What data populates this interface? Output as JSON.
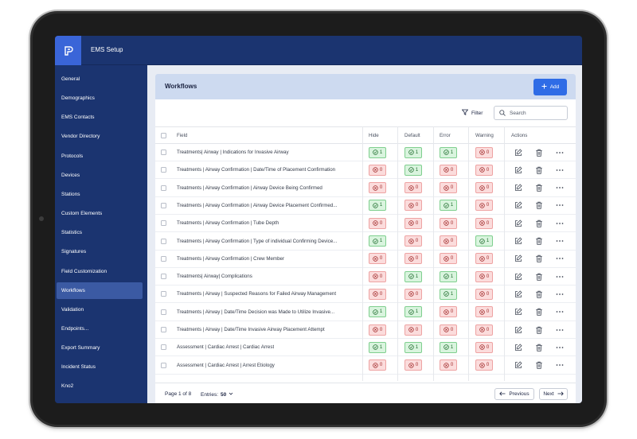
{
  "app": {
    "title": "EMS Setup"
  },
  "sidebar": {
    "items": [
      {
        "label": "General"
      },
      {
        "label": "Demographics"
      },
      {
        "label": "EMS Contacts"
      },
      {
        "label": "Vendor Directory"
      },
      {
        "label": "Protocols"
      },
      {
        "label": "Devices"
      },
      {
        "label": "Stations"
      },
      {
        "label": "Custom Elements"
      },
      {
        "label": "Statistics"
      },
      {
        "label": "Signatures"
      },
      {
        "label": "Field Customization"
      },
      {
        "label": "Workflows",
        "active": true
      },
      {
        "label": "Validation"
      },
      {
        "label": "Endpoints..."
      },
      {
        "label": "Export Summary"
      },
      {
        "label": "Incident Status"
      },
      {
        "label": "Kno2"
      }
    ]
  },
  "card": {
    "title": "Workflows",
    "add_label": "Add",
    "filter_label": "Filter",
    "search_placeholder": "Search"
  },
  "table": {
    "columns": {
      "field": "Field",
      "hide": "Hide",
      "default": "Default",
      "error": "Error",
      "warning": "Warning",
      "actions": "Actions"
    },
    "rows": [
      {
        "field": "Treatments| Airway | Indications for Invasive Airway",
        "hide": "1",
        "default": "1",
        "error": "1",
        "warning": "0"
      },
      {
        "field": "Treatments | Airway Confirmation | Date/Time of Placement Confirmation",
        "hide": "0",
        "default": "1",
        "error": "0",
        "warning": "0"
      },
      {
        "field": "Treatments | Airway Confirmation | Airway Device Being Confirmed",
        "hide": "0",
        "default": "0",
        "error": "0",
        "warning": "0"
      },
      {
        "field": "Treatments | Airway Confirmation | Airway Device Placement Confirmed...",
        "hide": "1",
        "default": "0",
        "error": "1",
        "warning": "0"
      },
      {
        "field": "Treatments | Airway Confirmation | Tube Depth",
        "hide": "0",
        "default": "0",
        "error": "0",
        "warning": "0"
      },
      {
        "field": "Treatments | Airway Confirmation | Type of individual Confirming Device...",
        "hide": "1",
        "default": "0",
        "error": "0",
        "warning": "1"
      },
      {
        "field": "Treatments | Airway Confirmation | Crew Member",
        "hide": "0",
        "default": "0",
        "error": "0",
        "warning": "0"
      },
      {
        "field": "Treatments| Airway| Complications",
        "hide": "0",
        "default": "1",
        "error": "1",
        "warning": "0"
      },
      {
        "field": "Treatments | Airway | Suspected Reasons for Failed Airway Management",
        "hide": "0",
        "default": "0",
        "error": "1",
        "warning": "0"
      },
      {
        "field": "Treatments | Airway | Date/Time Decision was Made to Utilize Invasive...",
        "hide": "1",
        "default": "1",
        "error": "0",
        "warning": "0"
      },
      {
        "field": "Treatments | Airway | Date/Time Invasive Airway Placement Attempt",
        "hide": "0",
        "default": "0",
        "error": "0",
        "warning": "0"
      },
      {
        "field": "Assessment | Cardiac Arrest | Cardiac Arrest",
        "hide": "1",
        "default": "1",
        "error": "1",
        "warning": "0"
      },
      {
        "field": "Assessment | Cardiac Arrest | Arrest Etiology",
        "hide": "0",
        "default": "0",
        "error": "0",
        "warning": "0"
      }
    ]
  },
  "footer": {
    "page_info": "Page 1 of 8",
    "entries_label": "Entries:",
    "entries_value": "50",
    "previous_label": "Previous",
    "next_label": "Next"
  }
}
